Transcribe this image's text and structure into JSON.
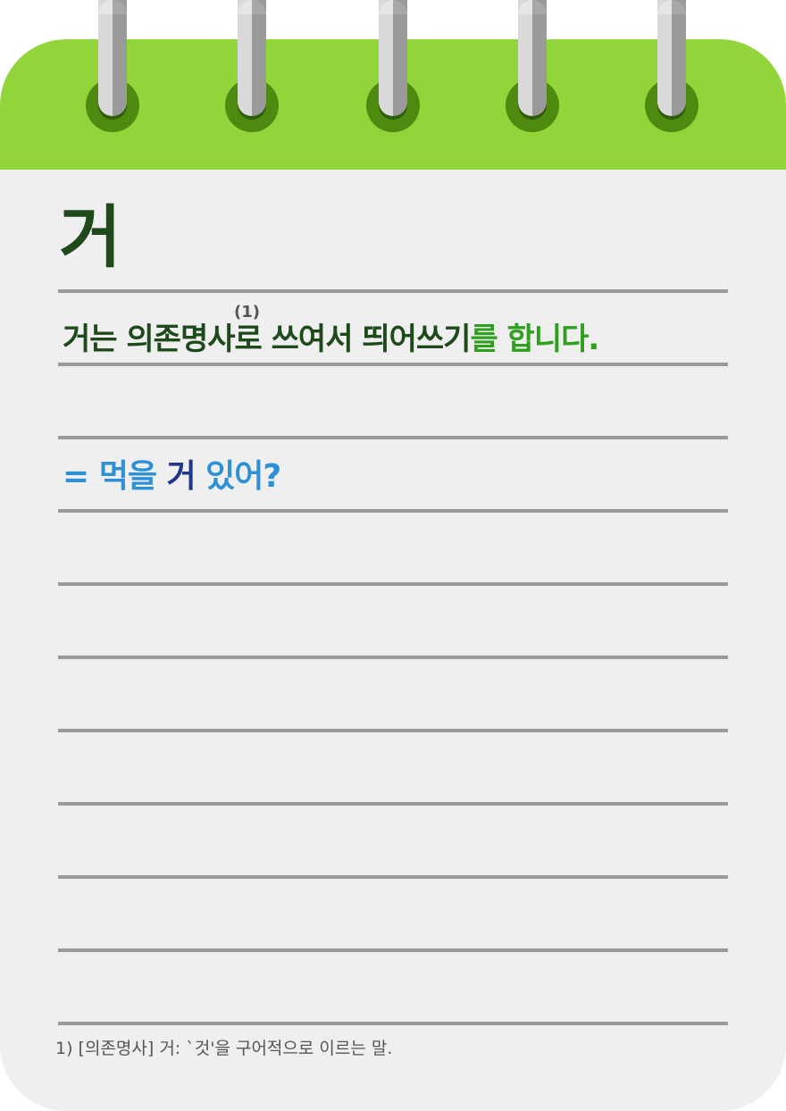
{
  "colors": {
    "header_green": "#91d53b",
    "ring_hole": "#4f8a10",
    "title": "#1e4a1b",
    "highlight_green": "#2e9f1e",
    "example_blue": "#2e91d6",
    "example_highlight": "#24368a",
    "paper": "#efefef",
    "rule_line": "#9a9a9a"
  },
  "header": {
    "binder_rings": [
      "ring-icon",
      "ring-icon",
      "ring-icon",
      "ring-icon",
      "ring-icon"
    ]
  },
  "title": "거",
  "sentence": {
    "part1": "거는 의존명사로 쓰여서 띄어쓰기",
    "part2": "를 합니다.",
    "footnote_marker": "(1)"
  },
  "example": {
    "prefix": "= 먹을 ",
    "highlight": "거",
    "suffix": " 있어?"
  },
  "footnote": "1) [의존명사] 거: `것'을 구어적으로 이르는 말."
}
